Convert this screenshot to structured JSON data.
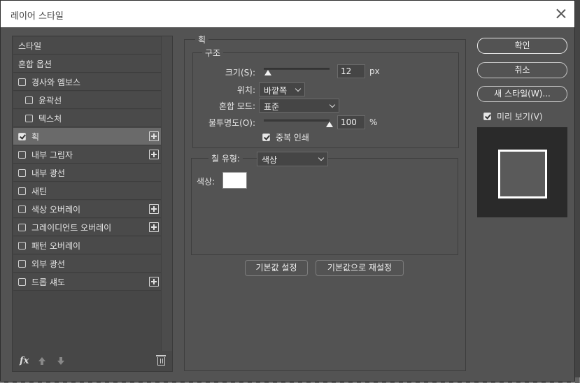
{
  "window": {
    "title": "레이어 스타일"
  },
  "styles_list": [
    {
      "label": "스타일",
      "checkbox": false,
      "checked": false,
      "plus": false,
      "indent": false,
      "selected": false
    },
    {
      "label": "혼합 옵션",
      "checkbox": false,
      "checked": false,
      "plus": false,
      "indent": false,
      "selected": false
    },
    {
      "label": "경사와 엠보스",
      "checkbox": true,
      "checked": false,
      "plus": false,
      "indent": false,
      "selected": false
    },
    {
      "label": "윤곽선",
      "checkbox": true,
      "checked": false,
      "plus": false,
      "indent": true,
      "selected": false
    },
    {
      "label": "텍스처",
      "checkbox": true,
      "checked": false,
      "plus": false,
      "indent": true,
      "selected": false
    },
    {
      "label": "획",
      "checkbox": true,
      "checked": true,
      "plus": true,
      "indent": false,
      "selected": true
    },
    {
      "label": "내부 그림자",
      "checkbox": true,
      "checked": false,
      "plus": true,
      "indent": false,
      "selected": false
    },
    {
      "label": "내부 광선",
      "checkbox": true,
      "checked": false,
      "plus": false,
      "indent": false,
      "selected": false
    },
    {
      "label": "새틴",
      "checkbox": true,
      "checked": false,
      "plus": false,
      "indent": false,
      "selected": false
    },
    {
      "label": "색상 오버레이",
      "checkbox": true,
      "checked": false,
      "plus": true,
      "indent": false,
      "selected": false
    },
    {
      "label": "그레이디언트 오버레이",
      "checkbox": true,
      "checked": false,
      "plus": true,
      "indent": false,
      "selected": false
    },
    {
      "label": "패턴 오버레이",
      "checkbox": true,
      "checked": false,
      "plus": false,
      "indent": false,
      "selected": false
    },
    {
      "label": "외부 광선",
      "checkbox": true,
      "checked": false,
      "plus": false,
      "indent": false,
      "selected": false
    },
    {
      "label": "드롭 섀도",
      "checkbox": true,
      "checked": false,
      "plus": true,
      "indent": false,
      "selected": false
    }
  ],
  "footer": {
    "fx_label": "fx"
  },
  "stroke": {
    "section_title": "획",
    "structure_title": "구조",
    "size_label": "크기(S):",
    "size_value": "12",
    "size_unit": "px",
    "size_slider_fraction": 0.06,
    "position_label": "위치:",
    "position_value": "바깥쪽",
    "blend_mode_label": "혼합 모드:",
    "blend_mode_value": "표준",
    "opacity_label": "불투명도(O):",
    "opacity_value": "100",
    "opacity_unit": "%",
    "opacity_slider_fraction": 1.0,
    "overprint_label": "중복 인쇄",
    "overprint_checked": true,
    "fill_type_label": "칠 유형:",
    "fill_type_value": "색상",
    "color_label": "색상:",
    "color_value": "#ffffff",
    "make_default_label": "기본값 설정",
    "reset_default_label": "기본값으로 재설정"
  },
  "actions": {
    "ok_label": "확인",
    "cancel_label": "취소",
    "new_style_label": "새 스타일(W)...",
    "preview_label": "미리 보기(V)",
    "preview_checked": true
  },
  "colors": {
    "dialog_bg": "#535353",
    "preview_bg": "#2a2a2a",
    "preview_stroke": "#ffffff"
  }
}
